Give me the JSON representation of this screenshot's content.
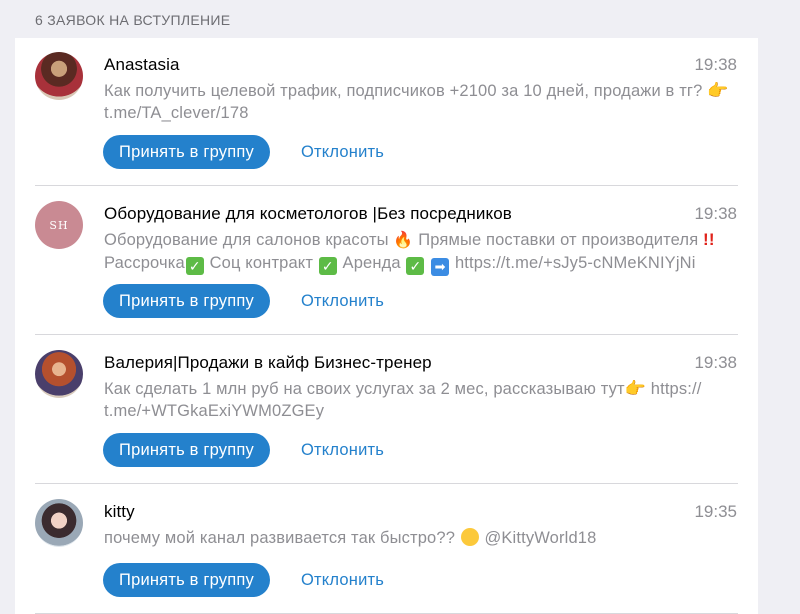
{
  "header": {
    "title": "6 ЗАЯВОК НА ВСТУПЛЕНИЕ"
  },
  "requests": [
    {
      "name": "Anastasia",
      "time": "19:38",
      "message_line1": "Как получить целевой трафик, подписчиков +2100 за 10 дней, продажи в тг?",
      "message_line2": "t.me/TA_clever/178",
      "accept_label": "Принять в группу",
      "decline_label": "Отклонить"
    },
    {
      "name": "Оборудование для косметологов |Без посредников",
      "time": "19:38",
      "message_line1": "Оборудование для салонов красоты",
      "message_line1b": "Прямые поставки от производителя",
      "message_line2a": "Рассрочка",
      "message_line2b": "Соц контракт",
      "message_line2c": "Аренда",
      "message_line2d": "https://t.me/+sJy5-cNMeKNIYjNi",
      "avatar_text": "SH",
      "accept_label": "Принять в группу",
      "decline_label": "Отклонить"
    },
    {
      "name": "Валерия|Продажи в кайф Бизнес-тренер",
      "time": "19:38",
      "message_line1": "Как сделать 1 млн руб на своих услугах за 2 мес, рассказываю тут",
      "message_line1b": "https://",
      "message_line2": "t.me/+WTGkaExiYWM0ZGEy",
      "accept_label": "Принять в группу",
      "decline_label": "Отклонить"
    },
    {
      "name": "kitty",
      "time": "19:35",
      "message_line1": "почему мой канал развивается так быстро??",
      "message_line1b": "@KittyWorld18",
      "accept_label": "Принять в группу",
      "decline_label": "Отклонить"
    }
  ],
  "colors": {
    "accent": "#2481cc",
    "background": "#efeff4",
    "secondary_text": "#8e8e93"
  },
  "icons": {
    "pointing_hand": "backhand-index-pointing-right-icon",
    "fire": "fire-icon",
    "double_exclamation": "double-exclamation-icon",
    "check": "check-mark-button-icon",
    "arrow": "right-arrow-icon",
    "flushed": "flushed-face-icon"
  }
}
